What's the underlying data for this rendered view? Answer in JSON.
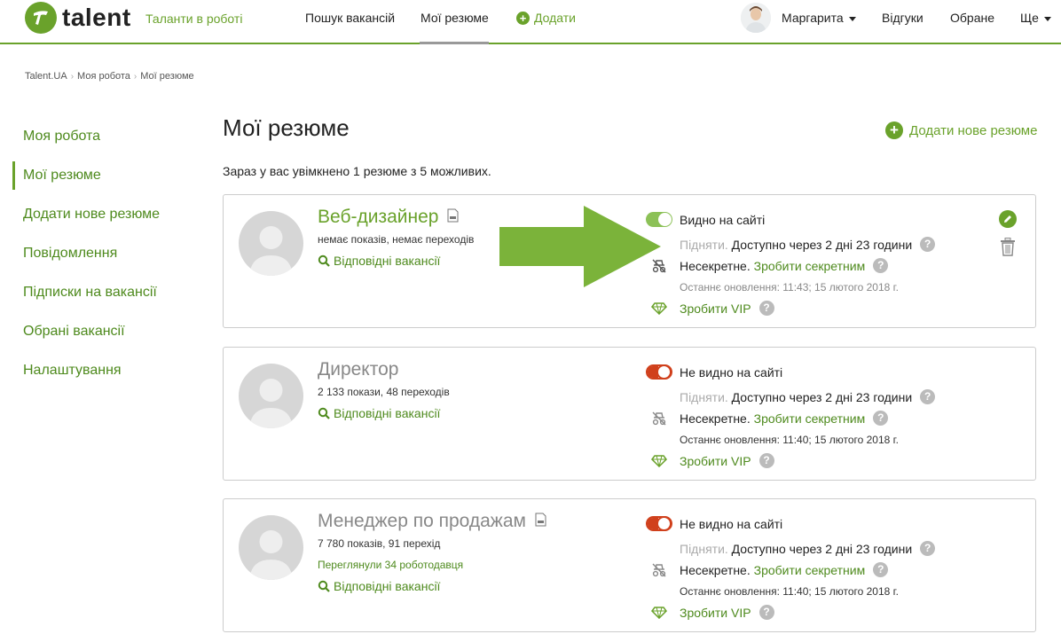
{
  "header": {
    "logo_text": "talent",
    "tagline": "Таланти в роботі",
    "nav": {
      "search": "Пошук вакансій",
      "my_resumes": "Мої резюме",
      "add": "Додати"
    },
    "user_name": "Маргарита",
    "feedback": "Відгуки",
    "favorites": "Обране",
    "more": "Ще"
  },
  "breadcrumb": [
    "Talent.UA",
    "Моя робота",
    "Мої резюме"
  ],
  "sidebar": {
    "items": [
      "Моя робота",
      "Мої резюме",
      "Додати нове резюме",
      "Повідомлення",
      "Підписки на вакансії",
      "Обрані вакансії",
      "Налаштування"
    ]
  },
  "main": {
    "title": "Мої резюме",
    "add_new": "Додати нове резюме",
    "summary": "Зараз у вас увімкнено 1 резюме з 5 можливих."
  },
  "resumes": [
    {
      "title": "Веб-дизайнер",
      "stats": "немає показів, немає переходів",
      "viewed": "",
      "matching": "Відповідні вакансії",
      "visible": true,
      "visibility_label": "Видно на сайті",
      "raise_label": "Підняти.",
      "raise_info": "Доступно через 2 дні 23 години",
      "secret_label": "Несекретне.",
      "secret_action": "Зробити секретним",
      "updated": "Останнє оновлення: 11:43; 15 лютого 2018 г.",
      "vip": "Зробити VIP"
    },
    {
      "title": "Директор",
      "stats": "2 133 покази, 48 переходів",
      "viewed": "",
      "matching": "Відповідні вакансії",
      "visible": false,
      "visibility_label": "Не видно на сайті",
      "raise_label": "Підняти.",
      "raise_info": "Доступно через 2 дні 23 години",
      "secret_label": "Несекретне.",
      "secret_action": "Зробити секретним",
      "updated": "Останнє оновлення: 11:40; 15 лютого 2018 г.",
      "vip": "Зробити VIP"
    },
    {
      "title": "Менеджер по продажам",
      "stats": "7 780 показів, 91 перехід",
      "viewed": "Переглянули 34 роботодавця",
      "matching": "Відповідні вакансії",
      "visible": false,
      "visibility_label": "Не видно на сайті",
      "raise_label": "Підняти.",
      "raise_info": "Доступно через 2 дні 23 години",
      "secret_label": "Несекретне.",
      "secret_action": "Зробити секретним",
      "updated": "Останнє оновлення: 11:40; 15 лютого 2018 г.",
      "vip": "Зробити VIP"
    }
  ],
  "help_glyph": "?",
  "colors": {
    "brand_green": "#6aa22b",
    "link_green": "#4e8a1d",
    "toggle_on": "#8cc157",
    "toggle_off": "#d0401c",
    "arrow": "#7bb33a"
  }
}
